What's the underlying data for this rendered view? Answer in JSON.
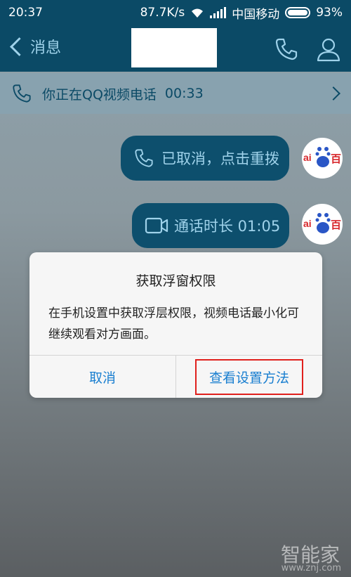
{
  "status": {
    "time": "20:37",
    "speed": "87.7K/s",
    "carrier": "中国移动",
    "battery": "93%"
  },
  "header": {
    "back_label": "消息"
  },
  "callbar": {
    "text": "你正在QQ视频电话",
    "duration": "00:33"
  },
  "messages": [
    {
      "text": "已取消，点击重拨",
      "icon": "phone-icon"
    },
    {
      "text": "通话时长 01:05",
      "icon": "video-icon"
    }
  ],
  "avatar": {
    "left_text": "ai",
    "right_text": "百"
  },
  "dialog": {
    "title": "获取浮窗权限",
    "body": "在手机设置中获取浮层权限，视频电话最小化可继续观看对方画面。",
    "cancel": "取消",
    "confirm": "查看设置方法"
  },
  "watermark": {
    "name": "智能家",
    "url": "www.znj.com"
  },
  "colors": {
    "header_bg": "#0b4a66",
    "bubble_bg": "#0d4f6d",
    "accent_blue": "#1a7fd0",
    "highlight_red": "#e0201d"
  }
}
